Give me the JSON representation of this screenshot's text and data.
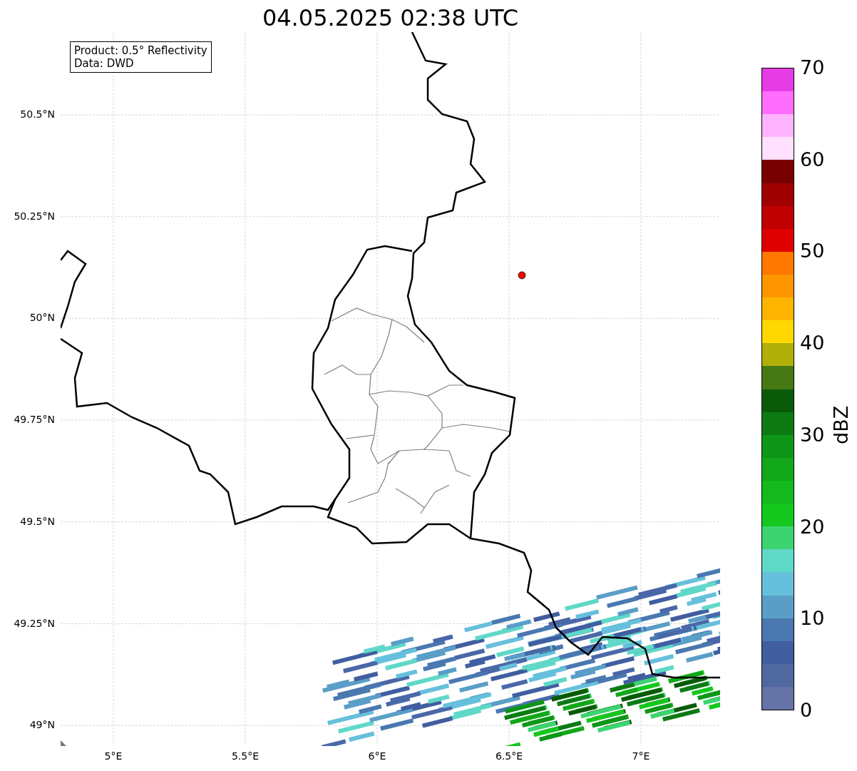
{
  "title": "04.05.2025 02:38 UTC",
  "info_box": [
    "Product: 0.5° Reflectivity",
    "Data: DWD"
  ],
  "map": {
    "lat_ticks": [
      "50.5°N",
      "50.25°N",
      "50°N",
      "49.75°N",
      "49.5°N",
      "49.25°N",
      "49°N"
    ],
    "lon_ticks": [
      "5°E",
      "5.5°E",
      "6°E",
      "6.5°E",
      "7°E"
    ]
  },
  "colorbar": {
    "label": "dBZ",
    "ticks": [
      "70",
      "60",
      "50",
      "40",
      "30",
      "20",
      "10",
      "0"
    ],
    "bands": [
      {
        "color": "#e63ce6"
      },
      {
        "color": "#ff6eff"
      },
      {
        "color": "#ffb4ff"
      },
      {
        "color": "#ffe0ff"
      },
      {
        "color": "#780000"
      },
      {
        "color": "#a00000"
      },
      {
        "color": "#c00000"
      },
      {
        "color": "#e00000"
      },
      {
        "color": "#ff7800"
      },
      {
        "color": "#ff9600"
      },
      {
        "color": "#ffb400"
      },
      {
        "color": "#ffd800"
      },
      {
        "color": "#b0b008"
      },
      {
        "color": "#467814"
      },
      {
        "color": "#0a5a0a"
      },
      {
        "color": "#0e7a14"
      },
      {
        "color": "#0e9618"
      },
      {
        "color": "#12a81a"
      },
      {
        "color": "#14b91e"
      },
      {
        "color": "#14c81e"
      },
      {
        "color": "#3cd470"
      },
      {
        "color": "#60d8c8"
      },
      {
        "color": "#66c0dc"
      },
      {
        "color": "#5a9ec8"
      },
      {
        "color": "#4a78b0"
      },
      {
        "color": "#405ea0"
      },
      {
        "color": "#5068a0"
      },
      {
        "color": "#6573a6"
      }
    ]
  }
}
